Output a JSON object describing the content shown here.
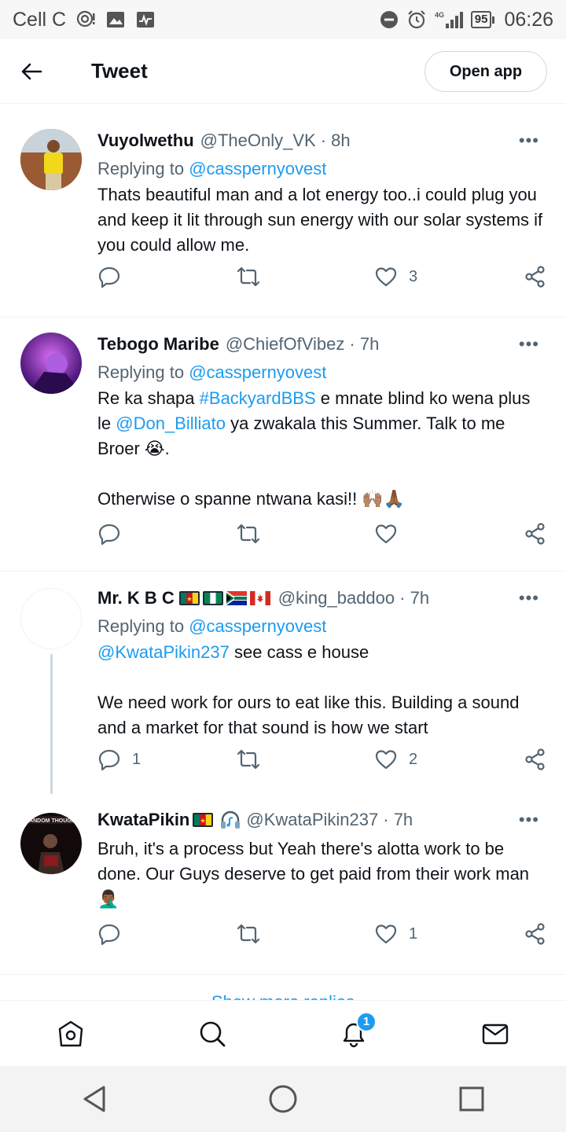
{
  "status": {
    "carrier": "Cell C",
    "network": "4G",
    "battery": "95",
    "time": "06:26"
  },
  "header": {
    "title": "Tweet",
    "open_app": "Open app"
  },
  "tweets": [
    {
      "name": "Vuyolwethu",
      "handle": "@TheOnly_VK",
      "time": "· 8h",
      "reply_prefix": "Replying to",
      "reply_to": "@casspernyovest",
      "text": "Thats beautiful man and a lot energy too..i could plug you and keep it lit through sun energy with our solar systems if you could allow me.",
      "replies": "",
      "retweets": "",
      "likes": "3"
    },
    {
      "name": "Tebogo Maribe",
      "handle": "@ChiefOfVibez",
      "time": "· 7h",
      "reply_prefix": "Replying to",
      "reply_to": "@casspernyovest",
      "text_1": "Re ka shapa",
      "hashtag": "#BackyardBBS",
      "text_2": "e mnate blind ko wena plus le",
      "mention": "@Don_Billiato",
      "text_3": "ya zwakala this Summer. Talk to me Broer",
      "emoji_1": "😭",
      "text_4": ".",
      "text_5": "Otherwise o spanne ntwana kasi!!",
      "emoji_2": "🙌🏽🙏🏾",
      "replies": "",
      "retweets": "",
      "likes": ""
    },
    {
      "name": "Mr. K B C",
      "handle": "@king_baddoo",
      "time": "· 7h",
      "reply_prefix": "Replying to",
      "reply_to": "@casspernyovest",
      "mention": "@KwataPikin237",
      "text_1": "see cass e house",
      "text_2": "We need work for ours to eat like this. Building a sound and a market for that sound is how we start",
      "replies": "1",
      "retweets": "",
      "likes": "2"
    },
    {
      "name": "KwataPikin",
      "handle": "@KwataPikin237",
      "time": "· 7h",
      "text": "Bruh, it's a process but Yeah there's alotta work to be done. Our Guys deserve to get paid from their work man",
      "emoji": "🤦🏾‍♂️",
      "replies": "",
      "retweets": "",
      "likes": "1"
    }
  ],
  "show_more": "Show more replies",
  "nav": {
    "notifications_badge": "1"
  },
  "icons": [
    "back-arrow-icon",
    "more-icon",
    "reply-icon",
    "retweet-icon",
    "like-icon",
    "share-icon",
    "home-icon",
    "search-icon",
    "bell-icon",
    "mail-icon"
  ],
  "colors": {
    "accent": "#1d9bf0",
    "text": "#0f1419",
    "muted": "#536471"
  }
}
